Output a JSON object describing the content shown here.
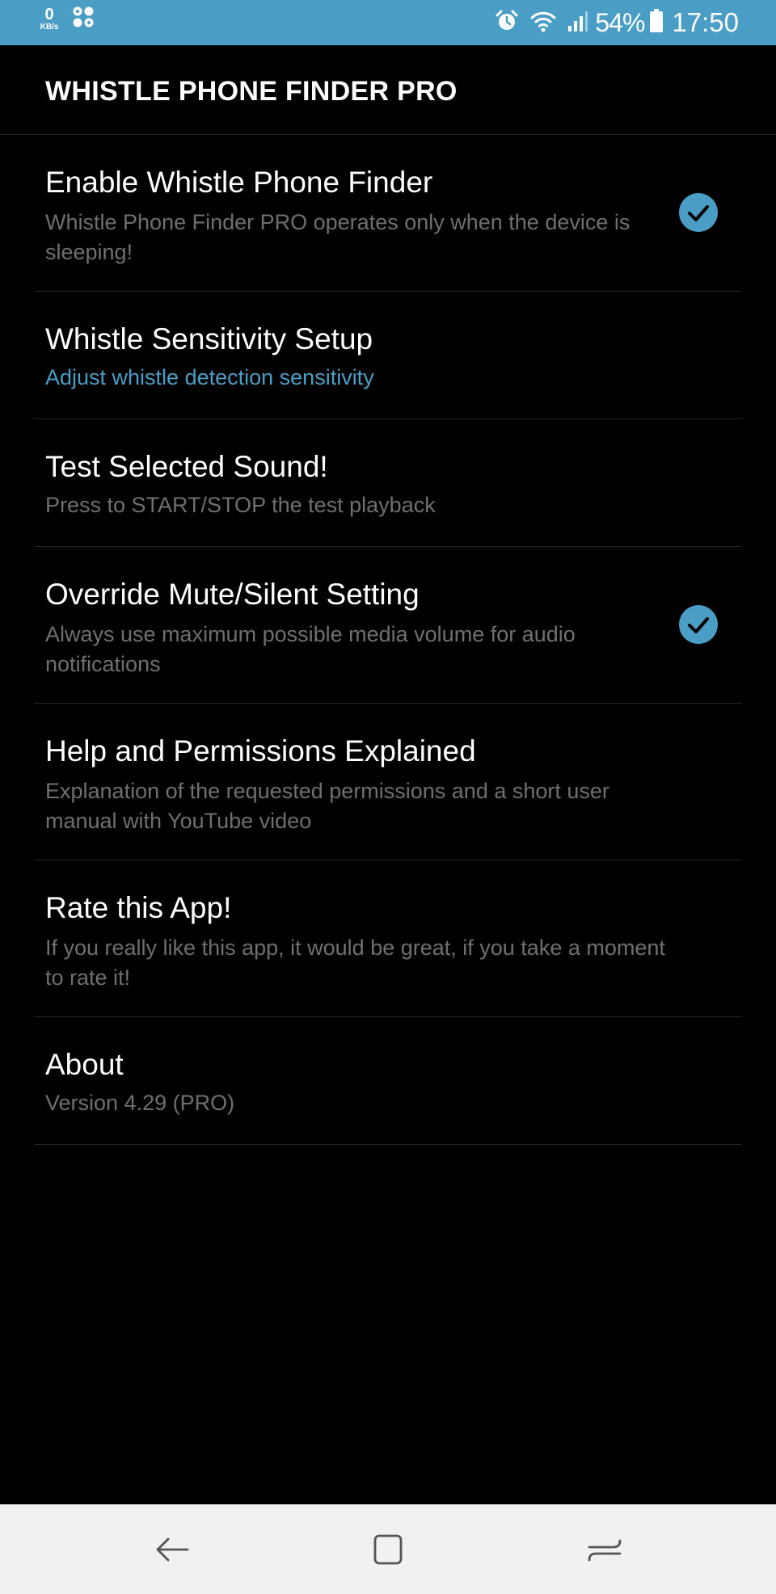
{
  "status_bar": {
    "net_speed_value": "0",
    "net_speed_unit": "KB/s",
    "battery_percent": "54%",
    "time": "17:50",
    "background_color": "#4a9dc4",
    "icons": [
      "net-speed-indicator",
      "app-notification-icon",
      "alarm-icon",
      "wifi-icon",
      "signal-icon",
      "battery-icon"
    ]
  },
  "app_bar": {
    "title": "WHISTLE PHONE FINDER PRO"
  },
  "preferences": [
    {
      "title": "Enable Whistle Phone Finder",
      "summary": "Whistle Phone Finder PRO operates only when the device is sleeping!",
      "checked": true
    },
    {
      "title": "Whistle Sensitivity Setup",
      "summary": "Adjust whistle detection sensitivity"
    },
    {
      "title": "Test Selected Sound!",
      "summary": "Press to START/STOP the test playback"
    },
    {
      "title": "Override Mute/Silent Setting",
      "summary": "Always use maximum possible media volume for audio notifications",
      "checked": true
    },
    {
      "title": "Help and Permissions Explained",
      "summary": "Explanation of the requested permissions and a short user manual with YouTube video"
    },
    {
      "title": "Rate this App!",
      "summary": "If you really like this app, it would be great, if you take a moment to rate it!"
    },
    {
      "title": "About",
      "summary": "Version 4.29 (PRO)"
    }
  ],
  "colors": {
    "accent": "#4a9dc4",
    "background": "#000000",
    "summary_text": "#6f6f6f",
    "title_text": "#ffffff",
    "nav_bar": "#f1f1f1"
  },
  "navigation_bar": {
    "buttons": [
      "back-icon",
      "home-icon",
      "recents-icon"
    ]
  }
}
